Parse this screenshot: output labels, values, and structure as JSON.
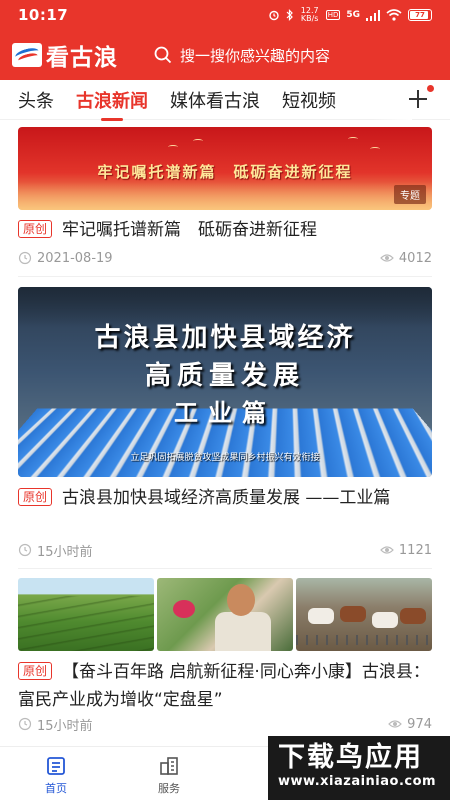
{
  "status_bar": {
    "time": "10:17",
    "net_speed": "12.7 KB/s",
    "hd": "HD",
    "signal": "5G",
    "battery": "77"
  },
  "header": {
    "app_name": "看古浪",
    "search_placeholder": "搜一搜你感兴趣的内容"
  },
  "tabs": [
    {
      "label": "头条"
    },
    {
      "label": "古浪新闻"
    },
    {
      "label": "媒体看古浪"
    },
    {
      "label": "短视频"
    }
  ],
  "feed": {
    "item1": {
      "banner_text": "牢记嘱托谱新篇　砥砺奋进新征程",
      "banner_tag": "专题",
      "badge": "原创",
      "title": "牢记嘱托谱新篇　砥砺奋进新征程",
      "date": "2021-08-19",
      "views": "4012"
    },
    "item2": {
      "banner_line1": "古浪县加快县域经济",
      "banner_line2": "高质量发展",
      "banner_line3": "工业篇",
      "banner_caption": "立足巩固拓展脱贫攻坚成果同乡村振兴有效衔接",
      "badge": "原创",
      "title": "古浪县加快县域经济高质量发展 ——工业篇",
      "time": "15小时前",
      "views": "1121"
    },
    "item3": {
      "badge": "原创",
      "title": "【奋斗百年路 启航新征程·同心奔小康】古浪县：富民产业成为增收“定盘星”",
      "time": "15小时前",
      "views": "974"
    }
  },
  "bottom_nav": {
    "home": "首页",
    "service": "服务"
  },
  "watermark": {
    "title": "下载鸟应用",
    "url": "www.xiazainiao.com"
  },
  "colors": {
    "brand_red": "#e8352b",
    "nav_active": "#2457d6"
  }
}
